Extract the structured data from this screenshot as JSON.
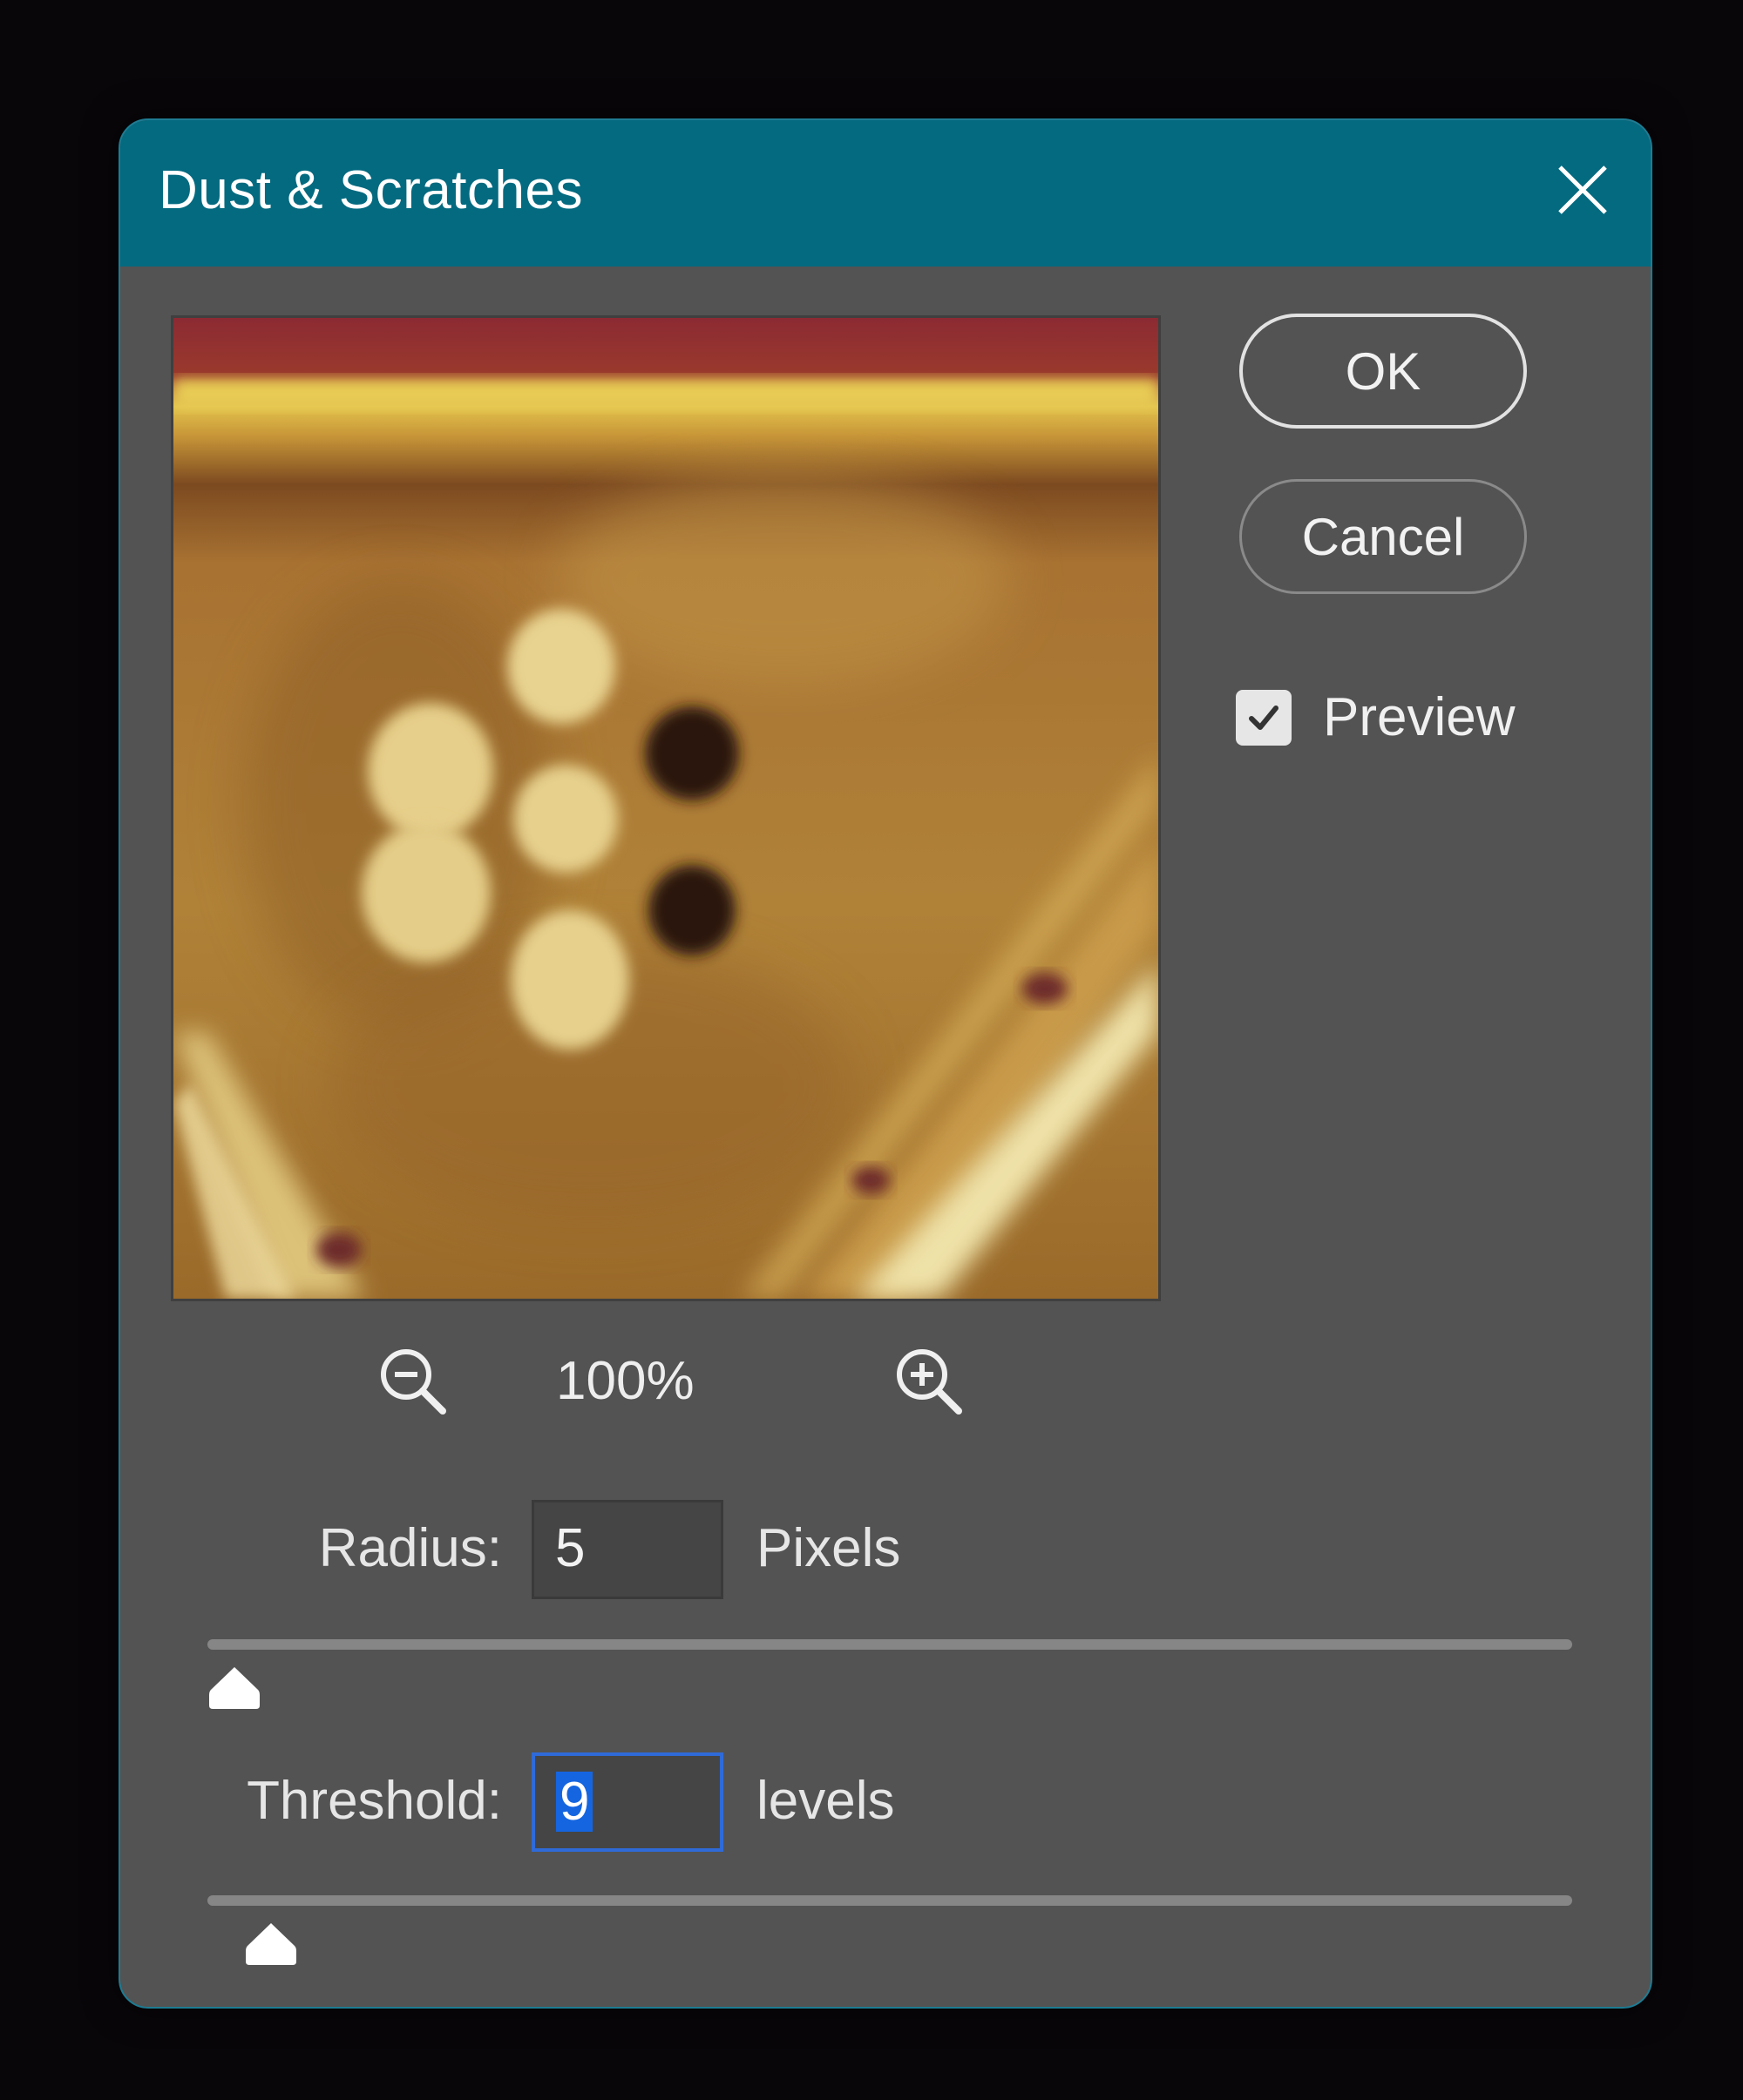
{
  "dialog": {
    "title": "Dust & Scratches",
    "title_bar_color": "#046a80"
  },
  "buttons": {
    "ok_label": "OK",
    "cancel_label": "Cancel"
  },
  "preview": {
    "label": "Preview",
    "checked": true
  },
  "zoom": {
    "level": "100%",
    "zoom_out_icon": "zoom-out-icon",
    "zoom_in_icon": "zoom-in-icon"
  },
  "radius": {
    "label": "Radius:",
    "value": "5",
    "unit": "Pixels",
    "slider_value": 5
  },
  "threshold": {
    "label": "Threshold:",
    "value": "9",
    "unit": "levels",
    "slider_value": 9
  },
  "colors": {
    "accent": "#1d7c93",
    "panel": "#535353",
    "selection": "#1565e0"
  }
}
